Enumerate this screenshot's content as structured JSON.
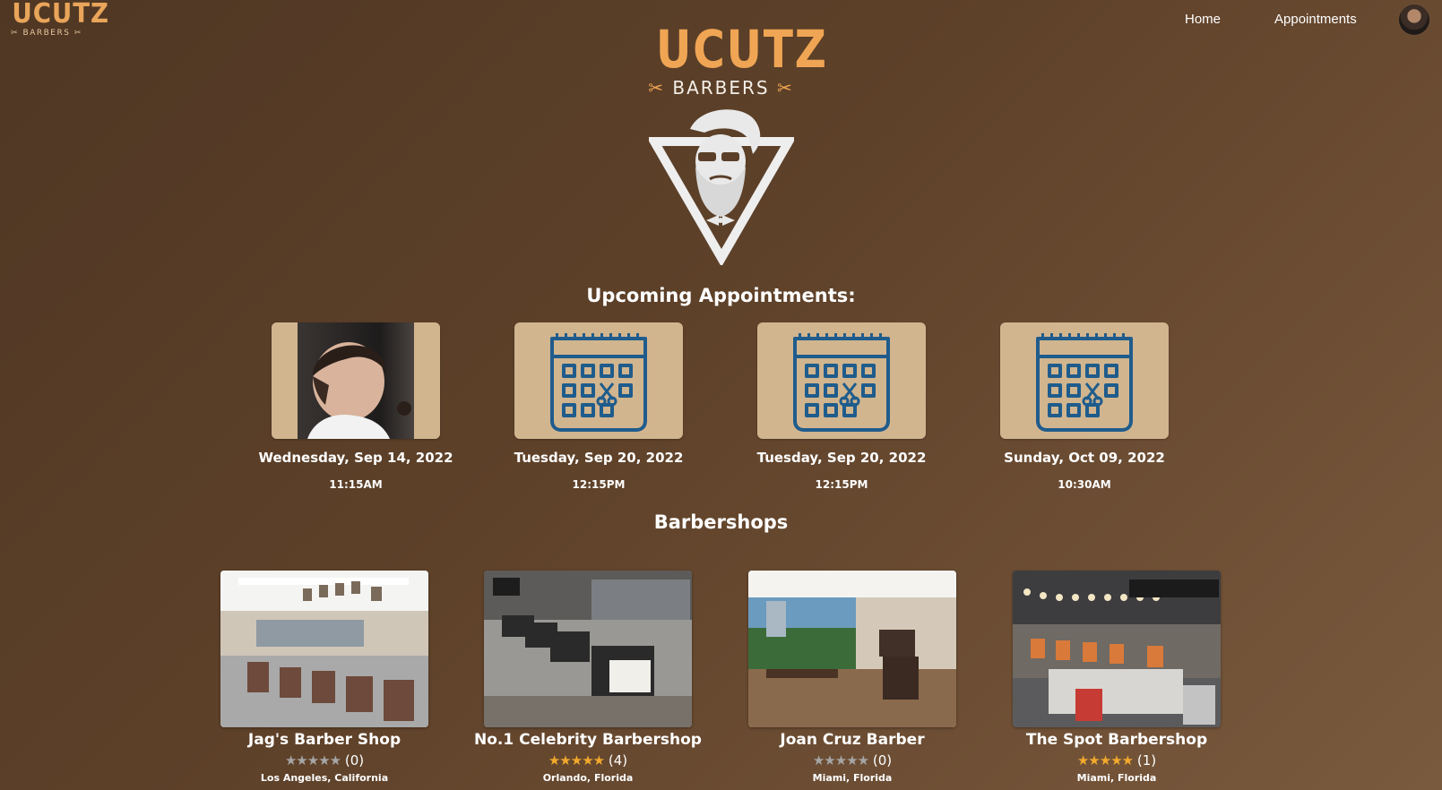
{
  "nav": {
    "logo_text": "UCUTZ",
    "logo_sub": "BARBERS",
    "links": [
      {
        "label": "Home"
      },
      {
        "label": "Appointments"
      }
    ],
    "avatar": "user-avatar"
  },
  "hero": {
    "brand": "UCUTZ",
    "sub": "BARBERS"
  },
  "appointments": {
    "heading": "Upcoming Appointments:",
    "items": [
      {
        "date": "Wednesday, Sep 14, 2022",
        "time": "11:15AM",
        "image": "haircut-photo"
      },
      {
        "date": "Tuesday, Sep 20, 2022",
        "time": "12:15PM",
        "image": "calendar-scissors-icon"
      },
      {
        "date": "Tuesday, Sep 20, 2022",
        "time": "12:15PM",
        "image": "calendar-scissors-icon"
      },
      {
        "date": "Sunday, Oct 09, 2022",
        "time": "10:30AM",
        "image": "calendar-scissors-icon"
      }
    ]
  },
  "barbershops": {
    "heading": "Barbershops",
    "items": [
      {
        "name": "Jag's Barber Shop",
        "stars": "★★★★★",
        "rating": 0,
        "rating_text": "(0)",
        "location": "Los Angeles, California",
        "star_color": "#a5a5a5"
      },
      {
        "name": "No.1 Celebrity Barbershop",
        "stars": "★★★★★",
        "rating": 4.5,
        "rating_text": "(4)",
        "location": "Orlando, Florida",
        "star_color": "#f2a92c"
      },
      {
        "name": "Joan Cruz Barber",
        "stars": "★★★★★",
        "rating": 0,
        "rating_text": "(0)",
        "location": "Miami, Florida",
        "star_color": "#a5a5a5"
      },
      {
        "name": "The Spot Barbershop",
        "stars": "★★★★★",
        "rating": 5,
        "rating_text": "(1)",
        "location": "Miami, Florida",
        "star_color": "#f2a92c"
      }
    ]
  },
  "colors": {
    "background": "#5b3f28",
    "accent": "#f0a554",
    "card": "#d1b58f",
    "calendar_icon": "#1f5c8c",
    "star_filled": "#f2a92c",
    "star_empty": "#a5a5a5"
  }
}
